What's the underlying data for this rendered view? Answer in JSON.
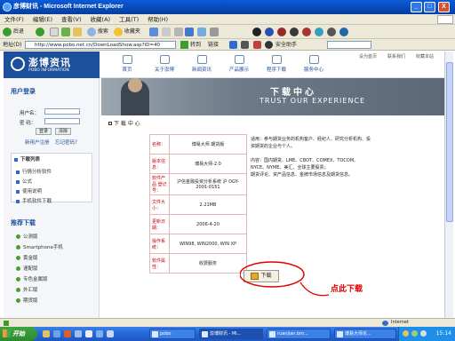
{
  "window": {
    "title": "彦博财讯 - Microsoft Internet Explorer",
    "controls": [
      "_",
      "□",
      "X"
    ]
  },
  "menu": [
    "文件(F)",
    "编辑(E)",
    "查看(V)",
    "收藏(A)",
    "工具(T)",
    "帮助(H)"
  ],
  "toolbar": {
    "back": "后退",
    "search": "搜索",
    "favorites": "收藏夹",
    "go": "转到",
    "links": "链接",
    "security": "安全助手"
  },
  "address": {
    "label": "地址(D)",
    "value": "http://www.pobo.net.cn/DownLoadShow.asp?ID=40"
  },
  "site": {
    "logo_text": "澎博资讯",
    "logo_sub": "POBO INFORMATION",
    "nav": [
      "首页",
      "关于澎博",
      "新闻资讯",
      "产品展示",
      "程序下载",
      "服务中心"
    ],
    "top_links": [
      "设为首页",
      "联系我们",
      "收藏本站"
    ]
  },
  "login": {
    "title": "用户登录",
    "user_label": "用户名：",
    "pass_label": "密  码：",
    "login_btn": "登录",
    "reset_btn": "清除",
    "register": "新用户注册",
    "forgot": "忘记密码？"
  },
  "download_menu": {
    "title": "下载列表",
    "items": [
      "行情分析软件",
      "公式",
      "使用说明",
      "手机软件下载"
    ]
  },
  "recommend": {
    "title": "推荐下载",
    "items": [
      "公测版",
      "Smartphone手机",
      "黄金版",
      "速配版",
      "专色金属版",
      "外汇版",
      "期货版"
    ]
  },
  "banner": {
    "title": "下载中心",
    "subtitle": "TRUST OUR EXPERIENCE"
  },
  "breadcrumb": "下 载 中 心",
  "software": {
    "rows": [
      {
        "key": "名称：",
        "value": "博易大师 期货版"
      },
      {
        "key": "版本信息：",
        "value": "博易大师-2.0"
      },
      {
        "key": "软件产品 登记号：",
        "value": "沪信金融投资分析系统 沪 DGY-2001-0151"
      },
      {
        "key": "文件大小：",
        "value": "2.21MB"
      },
      {
        "key": "更新日期：",
        "value": "2006-4-20"
      },
      {
        "key": "操作系统：",
        "value": "WIN98, WIN2000, WIN XP"
      },
      {
        "key": "软件属性：",
        "value": "收费服务"
      }
    ],
    "desc_lines": [
      "适用：参与期货业务的机构客户、经纪人、研究分析机构、投",
      "资期货的企业与个人。",
      "",
      "内容：国内期货、LME、CBOT、COMEX、TOCOM、",
      "NYCE、NYME、美汇、全球主要股票；",
      "期货评论、资产品信息、金牌市场信息及期货信息。"
    ],
    "download_btn": "下载"
  },
  "annotation": "点此下载",
  "status": {
    "zone": "Internet"
  },
  "taskbar": {
    "start": "开始",
    "tasks": [
      "pobo",
      "澎博财讯 - Mi...",
      "ruanjian.bm...",
      "博易大师论..."
    ],
    "time": "15:14"
  }
}
